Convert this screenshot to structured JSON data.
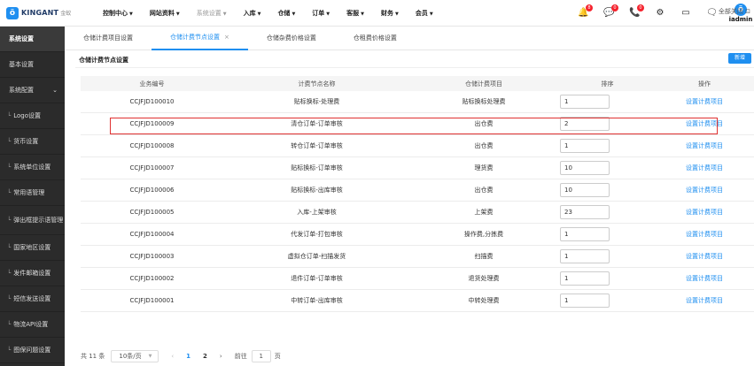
{
  "brand": {
    "name": "KINGANT",
    "sub": "金蚁"
  },
  "nav": [
    {
      "label": "控制中心",
      "dim": false
    },
    {
      "label": "网站资料",
      "dim": false
    },
    {
      "label": "系统设置",
      "dim": true
    },
    {
      "label": "入库",
      "dim": false
    },
    {
      "label": "仓储",
      "dim": false
    },
    {
      "label": "订单",
      "dim": false
    },
    {
      "label": "客服",
      "dim": false
    },
    {
      "label": "财务",
      "dim": false
    },
    {
      "label": "会员",
      "dim": false
    }
  ],
  "topicons": [
    {
      "name": "bell-icon",
      "glyph": "🔔",
      "badge": "8"
    },
    {
      "name": "chat-icon",
      "glyph": "💬",
      "badge": "0"
    },
    {
      "name": "phone-icon",
      "glyph": "📞",
      "badge": "0"
    },
    {
      "name": "settings-icon",
      "glyph": "⚙",
      "badge": ""
    },
    {
      "name": "monitor-icon",
      "glyph": "▭",
      "badge": ""
    },
    {
      "name": "message-icon",
      "glyph": "🗨",
      "badge": ""
    }
  ],
  "user": {
    "name": "iadmin"
  },
  "sidebar": {
    "title": "系统设置",
    "items": [
      {
        "label": "基本设置",
        "type": "plain"
      },
      {
        "label": "系统配置",
        "type": "header"
      },
      {
        "label": "Logo设置",
        "type": "sub"
      },
      {
        "label": "货币设置",
        "type": "sub"
      },
      {
        "label": "系统单位设置",
        "type": "sub"
      },
      {
        "label": "常用语管理",
        "type": "sub"
      },
      {
        "label": "弹出框提示语管理",
        "type": "subtall"
      },
      {
        "label": "国家地区设置",
        "type": "sub"
      },
      {
        "label": "发件邮箱设置",
        "type": "sub"
      },
      {
        "label": "短信发送设置",
        "type": "sub"
      },
      {
        "label": "物流API设置",
        "type": "sub"
      },
      {
        "label": "图保问题设置",
        "type": "sub"
      }
    ]
  },
  "tabs": [
    {
      "label": "仓储计费项目设置",
      "active": false
    },
    {
      "label": "仓储计费节点设置",
      "active": true
    },
    {
      "label": "仓储杂费价格设置",
      "active": false
    },
    {
      "label": "仓租费价格设置",
      "active": false
    }
  ],
  "close_all": "全部关闭",
  "panel": {
    "title": "仓储计费节点设置",
    "new_button": "新增"
  },
  "table": {
    "headers": [
      "业务编号",
      "计费节点名称",
      "仓储计费项目",
      "排序",
      "操作"
    ],
    "rows": [
      [
        "CCJFJD100010",
        "贴标换标-处理费",
        "贴标换标处理费",
        "1",
        "设置计费项目"
      ],
      [
        "CCJFJD100009",
        "清仓订单-订单审核",
        "出仓费",
        "2",
        "设置计费项目"
      ],
      [
        "CCJFJD100008",
        "转仓订单-订单审核",
        "出仓费",
        "1",
        "设置计费项目"
      ],
      [
        "CCJFJD100007",
        "贴标换标-订单审核",
        "理货费",
        "10",
        "设置计费项目"
      ],
      [
        "CCJFJD100006",
        "贴标换标-出库审核",
        "出仓费",
        "10",
        "设置计费项目"
      ],
      [
        "CCJFJD100005",
        "入库-上架审核",
        "上架费",
        "23",
        "设置计费项目"
      ],
      [
        "CCJFJD100004",
        "代发订单-打包审核",
        "操作费,分拣费",
        "1",
        "设置计费项目"
      ],
      [
        "CCJFJD100003",
        "虚拟仓订单-扫描发货",
        "扫描费",
        "1",
        "设置计费项目"
      ],
      [
        "CCJFJD100002",
        "退件订单-订单审核",
        "退货处理费",
        "1",
        "设置计费项目"
      ],
      [
        "CCJFJD100001",
        "中转订单-出库审核",
        "中转处理费",
        "1",
        "设置计费项目"
      ]
    ]
  },
  "pager": {
    "total": "共 11 条",
    "page_size": "10条/页",
    "pages": [
      "1",
      "2"
    ],
    "goto_label": "前往",
    "goto_value": "1",
    "goto_suffix": "页"
  }
}
